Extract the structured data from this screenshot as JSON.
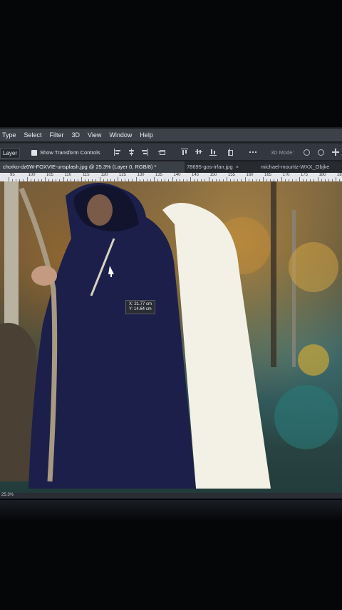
{
  "menu": [
    "Type",
    "Select",
    "Filter",
    "3D",
    "View",
    "Window",
    "Help"
  ],
  "options": {
    "layer_label": "Layer",
    "show_transform_label": "Show Transform Controls",
    "mode_3d": "3D Mode:"
  },
  "tabs": [
    {
      "label": "chorko-dz6W-FOXVIE-unsplash.jpg @ 25.3% (Layer 0, RGB/8) *",
      "active": true
    },
    {
      "label": "78695-gos-irfan.jpg",
      "active": false
    },
    {
      "label": "michael-mouritz-WXX_Objke",
      "active": false
    }
  ],
  "ruler": [
    "95",
    "100",
    "105",
    "110",
    "115",
    "120",
    "125",
    "130",
    "135",
    "140",
    "145",
    "150",
    "155",
    "160",
    "165",
    "170",
    "175",
    "180",
    "185"
  ],
  "tooltip": {
    "x": "X: 21.77 cm",
    "y": "Y: 14.64 cm"
  },
  "status": "25.3%",
  "icons": [
    "checkbox-icon",
    "align-icon",
    "3d-orbit-icon",
    "close-icon",
    "move-cursor-icon"
  ],
  "colors": {
    "menubar": "#3c4048",
    "optbar": "#33373f",
    "cloak": "#1b1f4a",
    "selection": "#f3f1e6"
  }
}
